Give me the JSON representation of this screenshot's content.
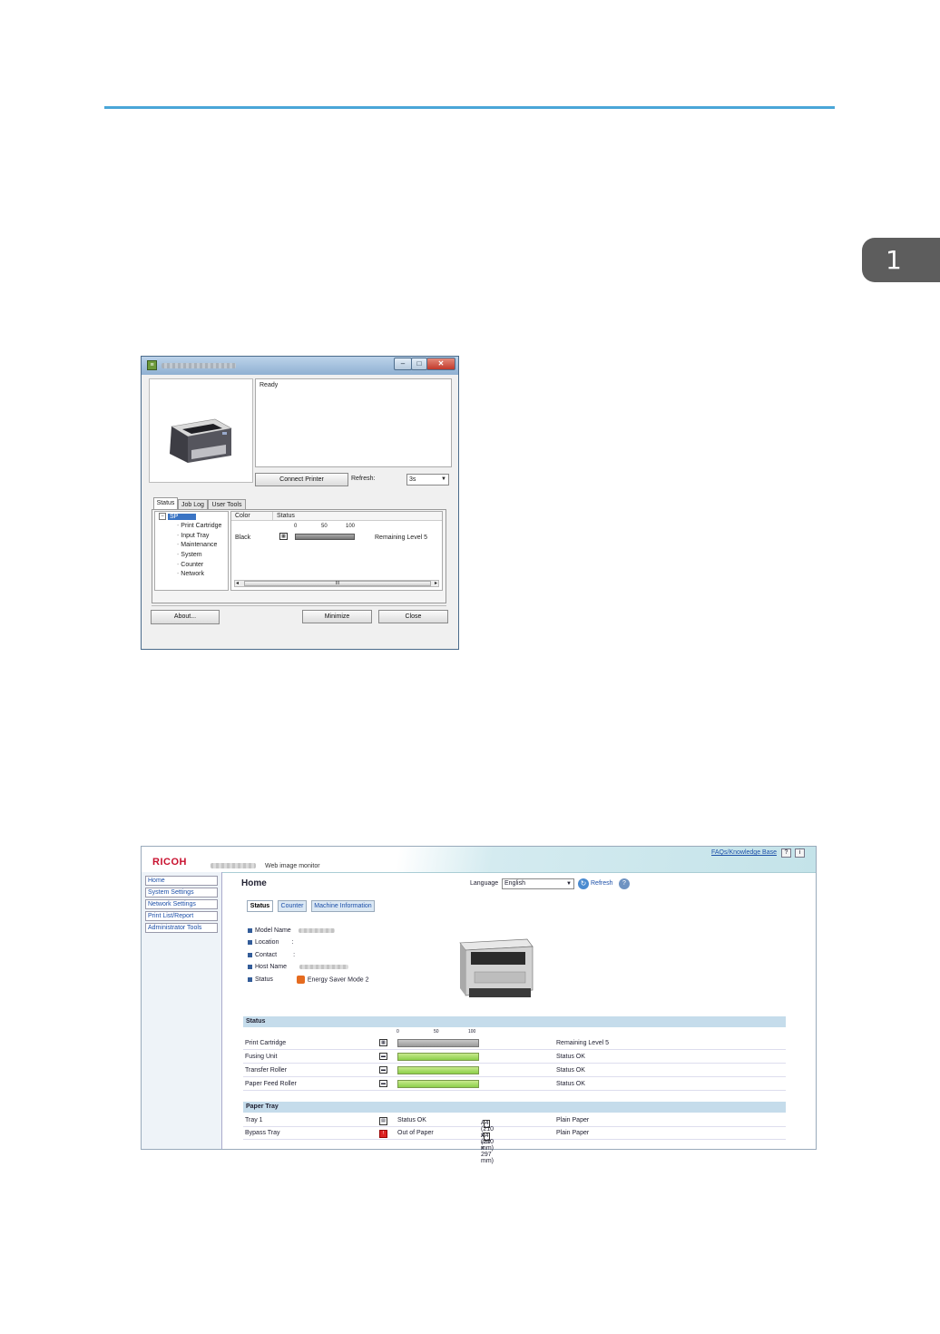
{
  "chapter_tab": "1",
  "status_monitor": {
    "status_text": "Ready",
    "connect_button": "Connect Printer",
    "refresh_label": "Refresh:",
    "refresh_value": "3s",
    "tabs": [
      "Status",
      "Job Log",
      "User Tools"
    ],
    "tree_root": "SP",
    "tree_items": [
      "Print Cartridge",
      "Input Tray",
      "Maintenance",
      "System",
      "Counter",
      "Network"
    ],
    "grid_headers": [
      "Color",
      "Status"
    ],
    "scale": [
      "0",
      "50",
      "100"
    ],
    "row_color": "Black",
    "row_status": "Remaining Level 5",
    "scroll_label": "III",
    "buttons": {
      "about": "About...",
      "minimize": "Minimize",
      "close": "Close"
    }
  },
  "web_image_monitor": {
    "brand": "RICOH",
    "title": "Web image monitor",
    "faq_link": "FAQs/Knowledge Base",
    "nav": [
      "Home",
      "System Settings",
      "Network Settings",
      "Print List/Report",
      "Administrator Tools"
    ],
    "page_title": "Home",
    "language_label": "Language",
    "language_value": "English",
    "refresh": "Refresh",
    "tabs": [
      "Status",
      "Counter",
      "Machine Information"
    ],
    "info": {
      "model_name": "Model Name",
      "location": "Location",
      "location_value": ":",
      "contact": "Contact",
      "contact_value": ":",
      "host_name": "Host Name",
      "status": "Status",
      "status_value": "Energy Saver Mode 2"
    },
    "status_section": "Status",
    "scale": [
      "0",
      "50",
      "100"
    ],
    "status_rows": [
      {
        "label": "Print Cartridge",
        "state": "Remaining Level 5",
        "level": "gray"
      },
      {
        "label": "Fusing Unit",
        "state": "Status OK",
        "level": "green"
      },
      {
        "label": "Transfer Roller",
        "state": "Status OK",
        "level": "green"
      },
      {
        "label": "Paper Feed Roller",
        "state": "Status OK",
        "level": "green"
      }
    ],
    "tray_section": "Paper Tray",
    "tray_rows": [
      {
        "label": "Tray 1",
        "state": "Status OK",
        "size": "A4 (210 x 297 mm)",
        "type": "Plain Paper"
      },
      {
        "label": "Bypass Tray",
        "state": "Out of Paper",
        "size": "A4 (210 x 297 mm)",
        "type": "Plain Paper"
      }
    ]
  }
}
